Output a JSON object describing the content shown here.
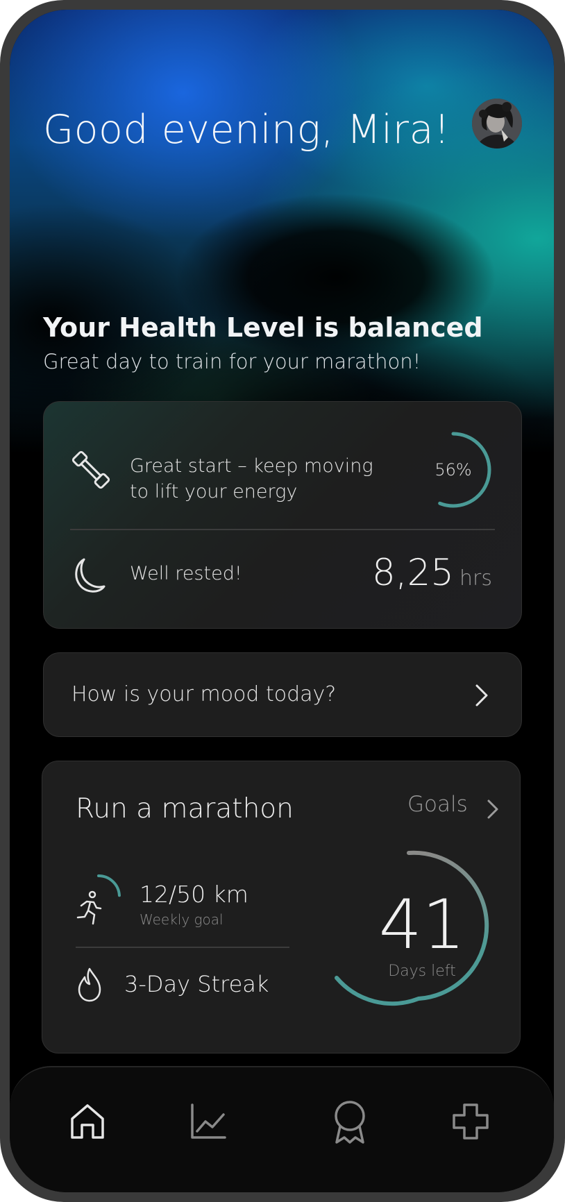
{
  "header": {
    "greeting": "Good evening, Mira!"
  },
  "status": {
    "title": "Your Health Level is balanced",
    "subtitle": "Great day to train for your marathon!"
  },
  "activity": {
    "line1": "Great start – keep moving",
    "line2": "to lift your energy",
    "percent_label": "56%",
    "progress": 0.56
  },
  "sleep": {
    "label": "Well rested!",
    "value": "8,25",
    "unit": "hrs"
  },
  "mood": {
    "prompt": "How is your mood today?"
  },
  "marathon": {
    "title": "Run a marathon",
    "goals_label": "Goals",
    "distance": "12/50 km",
    "distance_label": "Weekly goal",
    "distance_progress": 0.24,
    "streak": "3-Day Streak",
    "days_value": "41",
    "days_label": "Days left"
  },
  "nav": {
    "items": [
      "home",
      "stats",
      "awards",
      "health"
    ]
  },
  "icons": {
    "activity": "dumbbell-icon",
    "sleep": "moon-icon",
    "mood_chevron": "chevron-right-icon",
    "run": "runner-icon",
    "streak": "flame-icon"
  },
  "colors": {
    "accent": "#4a9a96",
    "card_bg": "#1e1e1e",
    "background": "#000000"
  }
}
